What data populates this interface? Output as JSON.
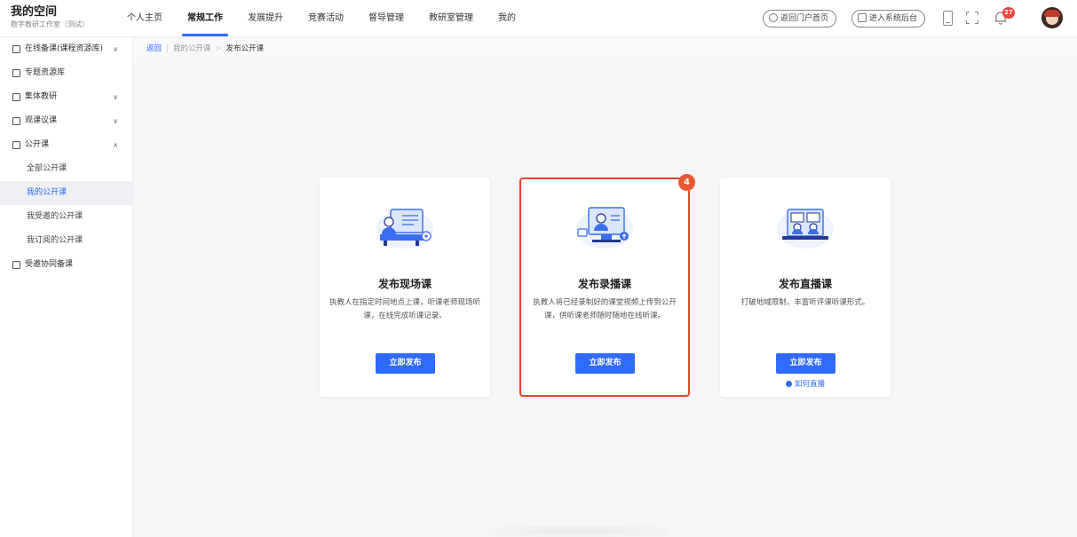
{
  "brand": {
    "title": "我的空间",
    "subtitle": "数字教研工作室（测试）"
  },
  "nav": {
    "items": [
      {
        "label": "个人主页",
        "active": false
      },
      {
        "label": "常规工作",
        "active": true
      },
      {
        "label": "发展提升",
        "active": false
      },
      {
        "label": "竞赛活动",
        "active": false
      },
      {
        "label": "督导管理",
        "active": false
      },
      {
        "label": "教研室管理",
        "active": false
      },
      {
        "label": "我的",
        "active": false
      }
    ]
  },
  "header": {
    "portal_label": "返回门户首页",
    "admin_label": "进入系统后台",
    "notification_count": "27"
  },
  "sidebar": {
    "items": [
      {
        "label": "在线备课(课程资源库)",
        "chevron": "∨"
      },
      {
        "label": "专题资源库",
        "chevron": ""
      },
      {
        "label": "集体教研",
        "chevron": "∨"
      },
      {
        "label": "观课议课",
        "chevron": "∨"
      },
      {
        "label": "公开课",
        "chevron": "∧"
      },
      {
        "label": "受邀协同备课",
        "chevron": ""
      }
    ],
    "subitems": [
      {
        "label": "全部公开课",
        "active": false
      },
      {
        "label": "我的公开课",
        "active": true
      },
      {
        "label": "我受邀的公开课",
        "active": false
      },
      {
        "label": "我订阅的公开课",
        "active": false
      }
    ]
  },
  "breadcrumb": {
    "back": "返回",
    "parent": "我的公开课",
    "current": "发布公开课"
  },
  "cards": [
    {
      "title": "发布现场课",
      "desc": "执教人在指定时间地点上课，听课老师现场听课，在线完成听课记录。",
      "button": "立即发布",
      "link": ""
    },
    {
      "title": "发布录播课",
      "desc": "执教人将已经录制好的课堂视频上传到公开课，供听课老师随时随地在线听课。",
      "button": "立即发布",
      "link": ""
    },
    {
      "title": "发布直播课",
      "desc": "打破地域限制，丰富听评课听课形式。",
      "button": "立即发布",
      "link": "如何直播"
    }
  ],
  "step_badge": "4",
  "colors": {
    "accent": "#2f6bff",
    "highlight": "#e0452b",
    "badge": "#e85a34",
    "notification": "#f04141"
  }
}
